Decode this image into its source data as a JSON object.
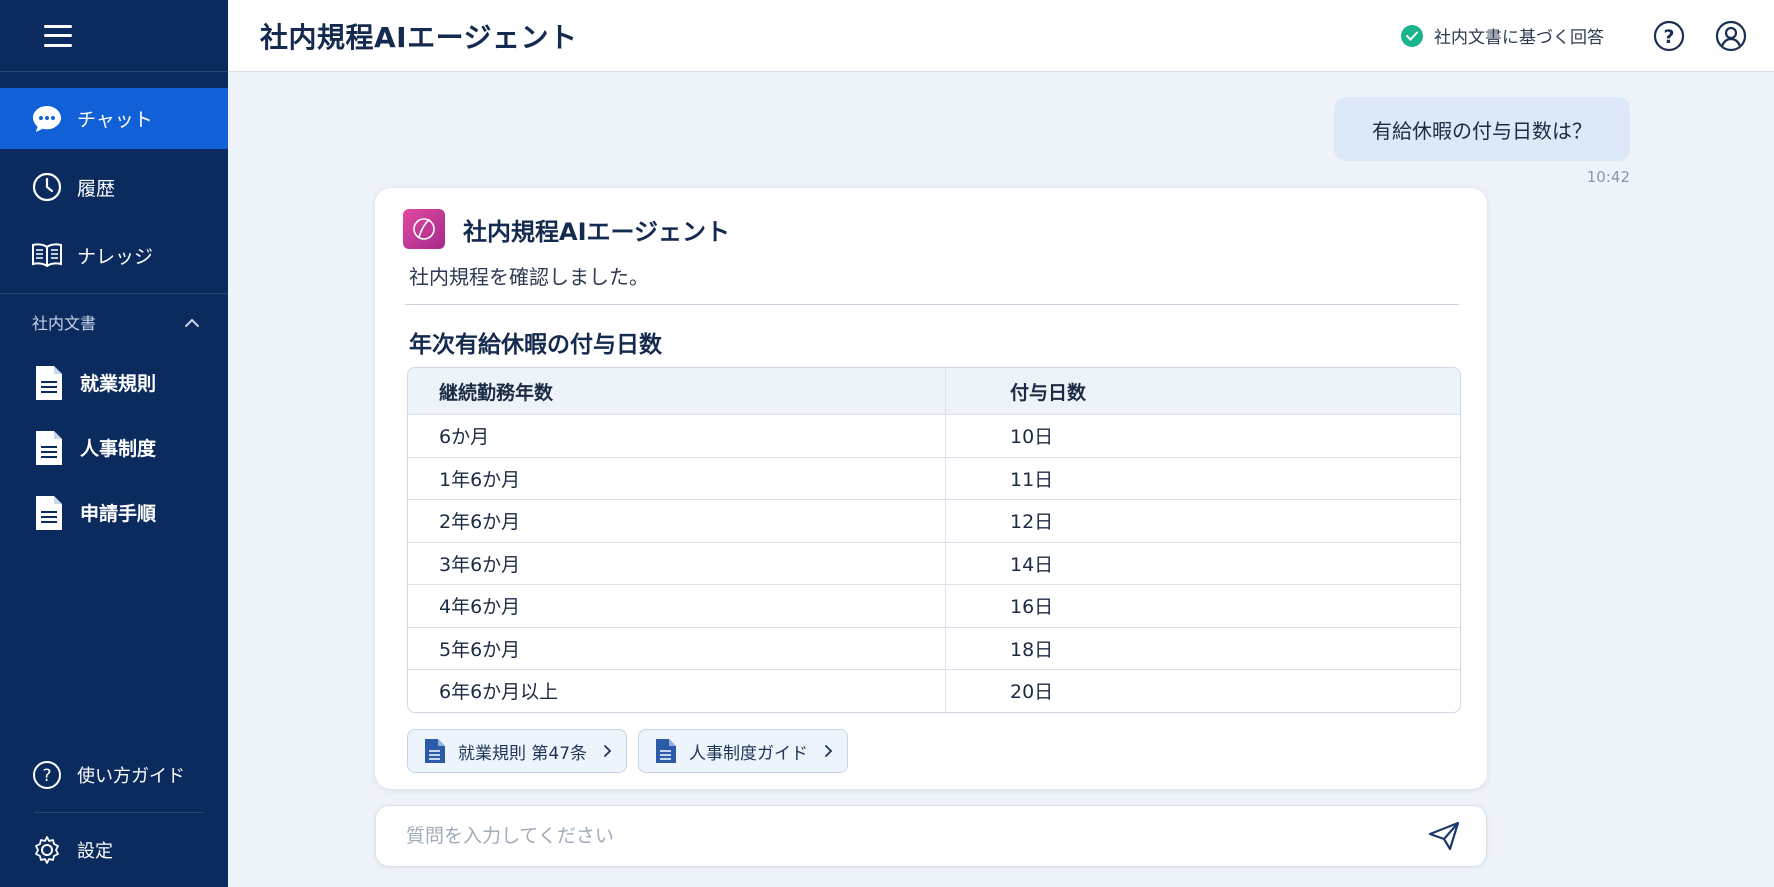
{
  "sidebar": {
    "nav": [
      {
        "label": "チャット",
        "icon": "chat-bubble-icon",
        "active": true
      },
      {
        "label": "履歴",
        "icon": "clock-icon"
      },
      {
        "label": "ナレッジ",
        "icon": "book-icon"
      }
    ],
    "section_title": "社内文書",
    "docs": [
      {
        "label": "就業規則",
        "icon": "document-icon"
      },
      {
        "label": "人事制度",
        "icon": "document-icon"
      },
      {
        "label": "申請手順",
        "icon": "document-icon"
      }
    ],
    "bottom": [
      {
        "label": "使い方ガイド",
        "icon": "help-circle-icon"
      },
      {
        "label": "設定",
        "icon": "gear-icon"
      }
    ]
  },
  "header": {
    "title": "社内規程AIエージェント",
    "verified_label": "社内文書に基づく回答"
  },
  "conversation": {
    "user_message": "有給休暇の付与日数は？",
    "user_time": "10:42",
    "assistant": {
      "name": "社内規程AIエージェント",
      "intro": "社内規程を確認しました。",
      "table_title": "年次有給休暇の付与日数",
      "columns": [
        "継続勤務年数",
        "付与日数"
      ],
      "rows": [
        [
          "6か月",
          "10日"
        ],
        [
          "1年6か月",
          "11日"
        ],
        [
          "2年6か月",
          "12日"
        ],
        [
          "3年6か月",
          "14日"
        ],
        [
          "4年6か月",
          "16日"
        ],
        [
          "5年6か月",
          "18日"
        ],
        [
          "6年6か月以上",
          "20日"
        ]
      ],
      "references": [
        "就業規則 第47条",
        "人事制度ガイド"
      ]
    }
  },
  "input": {
    "placeholder": "質問を入力してください",
    "value": ""
  },
  "colors": {
    "sidebar_bg": "#0b2a5e",
    "active_nav": "#1160d8",
    "verified_green": "#19b48c",
    "user_bubble": "#dde9f8"
  }
}
